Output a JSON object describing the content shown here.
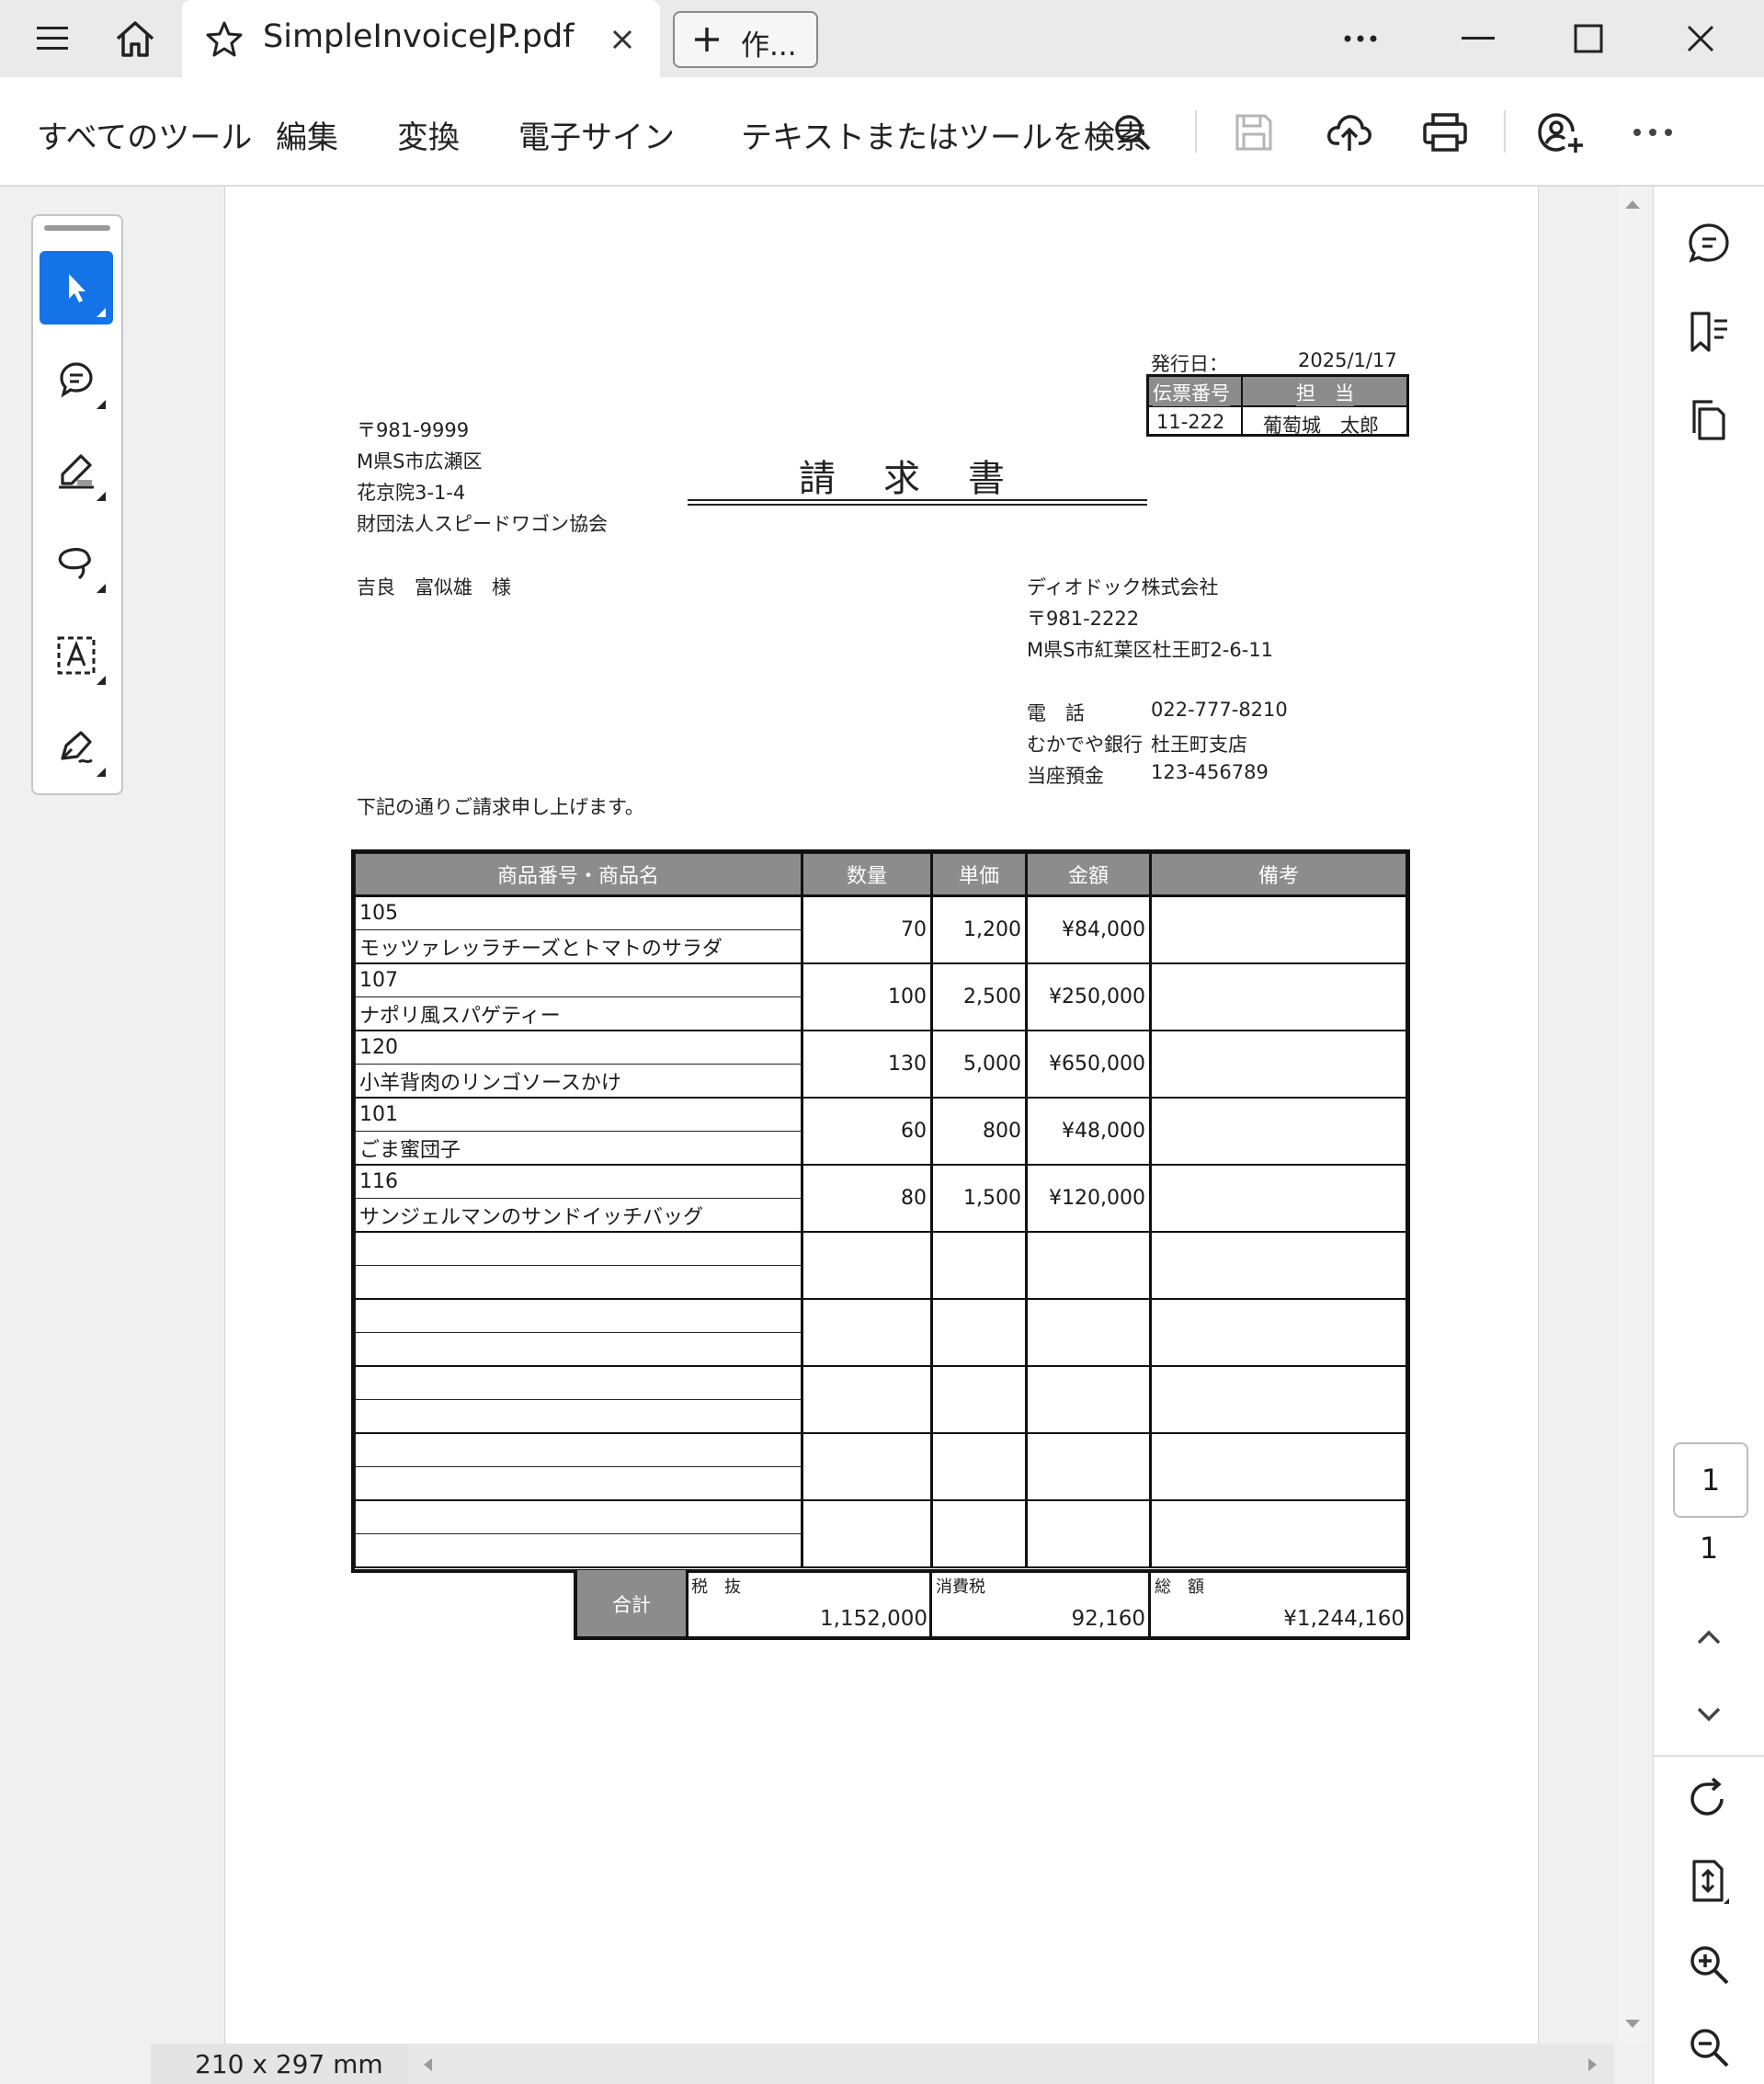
{
  "window": {
    "tab_title": "SimpleInvoiceJP.pdf",
    "new_tab_label": "作...",
    "icons": [
      "hamburger-menu-icon",
      "home-icon",
      "star-icon",
      "close-icon",
      "plus-icon",
      "more-horizontal-icon",
      "minimize-icon",
      "maximize-icon",
      "window-close-icon"
    ]
  },
  "toolbar": {
    "all_tools": "すべてのツール",
    "edit": "編集",
    "convert": "変換",
    "esign": "電子サイン",
    "search": "テキストまたはツールを検索"
  },
  "left_tools": [
    "select-tool",
    "comment-tool",
    "highlight-tool",
    "draw-tool",
    "text-select-tool",
    "sign-tool"
  ],
  "right_panel": {
    "page_input": "1",
    "page_total": "1"
  },
  "status": {
    "page_size": "210 x 297 mm"
  },
  "invoice": {
    "issue_label": "発行日：",
    "issue_date": "2025/1/17",
    "slip_header": "伝票番号",
    "staff_header": "担　当",
    "slip_no": "11-222",
    "staff_name": "葡萄城　太郎",
    "title": "請　求　書",
    "recipient": {
      "zip": "〒981-9999",
      "address1": "M県S市広瀬区",
      "address2": "花京院3-1-4",
      "org": "財団法人スピードワゴン協会",
      "name": "吉良　富似雄　様"
    },
    "sender": {
      "company": "ディオドック株式会社",
      "zip": "〒981-2222",
      "address": "M県S市紅葉区杜王町2-6-11",
      "tel_label": "電　話",
      "tel": "022-777-8210",
      "bank_label": "むかでや銀行",
      "bank_branch": "杜王町支店",
      "account_label": "当座預金",
      "account_no": "123-456789"
    },
    "message": "下記の通りご請求申し上げます。",
    "columns": [
      "商品番号・商品名",
      "数量",
      "単価",
      "金額",
      "備考"
    ],
    "items": [
      {
        "code": "105",
        "name": "モッツァレッラチーズとトマトのサラダ",
        "qty": "70",
        "price": "1,200",
        "amount": "¥84,000"
      },
      {
        "code": "107",
        "name": "ナポリ風スパゲティー",
        "qty": "100",
        "price": "2,500",
        "amount": "¥250,000"
      },
      {
        "code": "120",
        "name": "小羊背肉のリンゴソースかけ",
        "qty": "130",
        "price": "5,000",
        "amount": "¥650,000"
      },
      {
        "code": "101",
        "name": "ごま蜜団子",
        "qty": "60",
        "price": "800",
        "amount": "¥48,000"
      },
      {
        "code": "116",
        "name": "サンジェルマンのサンドイッチバッグ",
        "qty": "80",
        "price": "1,500",
        "amount": "¥120,000"
      }
    ],
    "totals": {
      "label": "合計",
      "subtotal_label": "税　抜",
      "subtotal": "1,152,000",
      "tax_label": "消費税",
      "tax": "92,160",
      "total_label": "総　額",
      "total": "¥1,244,160"
    }
  }
}
